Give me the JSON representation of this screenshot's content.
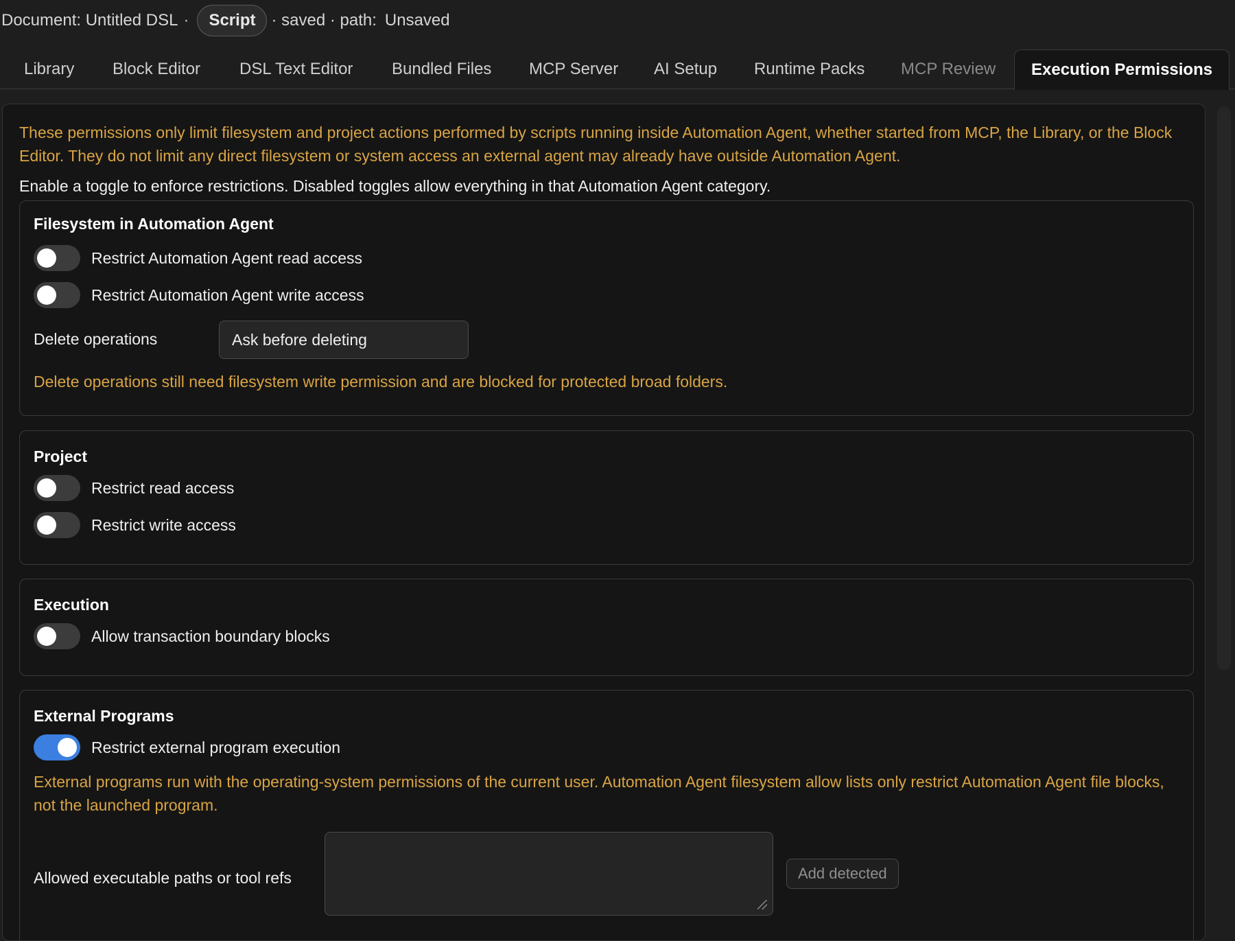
{
  "header": {
    "document_label": "Document: Untitled DSL",
    "sep1": "·",
    "mode_pill": "Script",
    "status_text": "· saved · path:",
    "path_value": "Unsaved"
  },
  "tabs": [
    {
      "label": "Library"
    },
    {
      "label": "Block Editor"
    },
    {
      "label": "DSL Text Editor"
    },
    {
      "label": "Bundled Files"
    },
    {
      "label": "MCP Server"
    },
    {
      "label": "AI Setup"
    },
    {
      "label": "Runtime Packs"
    },
    {
      "label": "MCP Review"
    },
    {
      "label": "Execution Permissions"
    }
  ],
  "active_tab": "Execution Permissions",
  "intro": {
    "warning": "These permissions only limit filesystem and project actions performed by scripts running inside Automation Agent, whether started from MCP, the Library, or the Block Editor. They do not limit any direct filesystem or system access an external agent may already have outside Automation Agent.",
    "enable_hint": "Enable a toggle to enforce restrictions. Disabled toggles allow everything in that Automation Agent category."
  },
  "filesystem": {
    "title": "Filesystem in Automation Agent",
    "read_toggle": {
      "label": "Restrict Automation Agent read access",
      "on": false
    },
    "write_toggle": {
      "label": "Restrict Automation Agent write access",
      "on": false
    },
    "delete_label": "Delete operations",
    "delete_value": "Ask before deleting",
    "delete_note": "Delete operations still need filesystem write permission and are blocked for protected broad folders."
  },
  "project": {
    "title": "Project",
    "read_toggle": {
      "label": "Restrict read access",
      "on": false
    },
    "write_toggle": {
      "label": "Restrict write access",
      "on": false
    }
  },
  "execution": {
    "title": "Execution",
    "transaction_toggle": {
      "label": "Allow transaction boundary blocks",
      "on": false
    }
  },
  "external_programs": {
    "title": "External Programs",
    "restrict_toggle": {
      "label": "Restrict external program execution",
      "on": true
    },
    "note": "External programs run with the operating-system permissions of the current user. Automation Agent filesystem allow lists only restrict Automation Agent file blocks, not the launched program.",
    "allowed_label": "Allowed executable paths or tool refs",
    "allowed_value": "",
    "add_detected_label": "Add detected"
  },
  "colors": {
    "background": "#1e1e1e",
    "panel": "#151515",
    "warning": "#d9a444",
    "toggle_on": "#3b7fe0",
    "toggle_off": "#3c3c3c"
  }
}
